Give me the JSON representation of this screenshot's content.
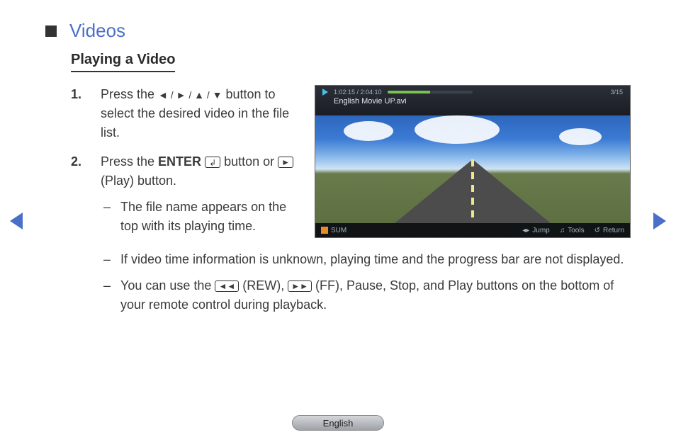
{
  "section_title": "Videos",
  "subsection_title": "Playing a Video",
  "steps": {
    "s1_pre": "Press the ",
    "s1_arrows": "◄ / ► / ▲ / ▼",
    "s1_post": " button to select the desired video in the file list.",
    "s2_pre": "Press the ",
    "s2_enter": "ENTER",
    "s2_mid": " button or ",
    "s2_play_label": "►",
    "s2_post": " (Play) button."
  },
  "sub_items": {
    "a": "The file name appears on the top with its playing time.",
    "b": "If video time information is unknown, playing time and the progress bar are not displayed.",
    "c_pre": "You can use the ",
    "c_rew": "◄◄",
    "c_mid1": " (REW), ",
    "c_ff": "►►",
    "c_post": " (FF), Pause, Stop, and Play buttons on the bottom of your remote control during playback."
  },
  "video": {
    "time": "1:02:15 / 2:04:10",
    "counter": "3/15",
    "filename": "English Movie UP.avi",
    "sum_label": "SUM",
    "jump_label": "Jump",
    "tools_label": "Tools",
    "return_label": "Return"
  },
  "language": "English"
}
